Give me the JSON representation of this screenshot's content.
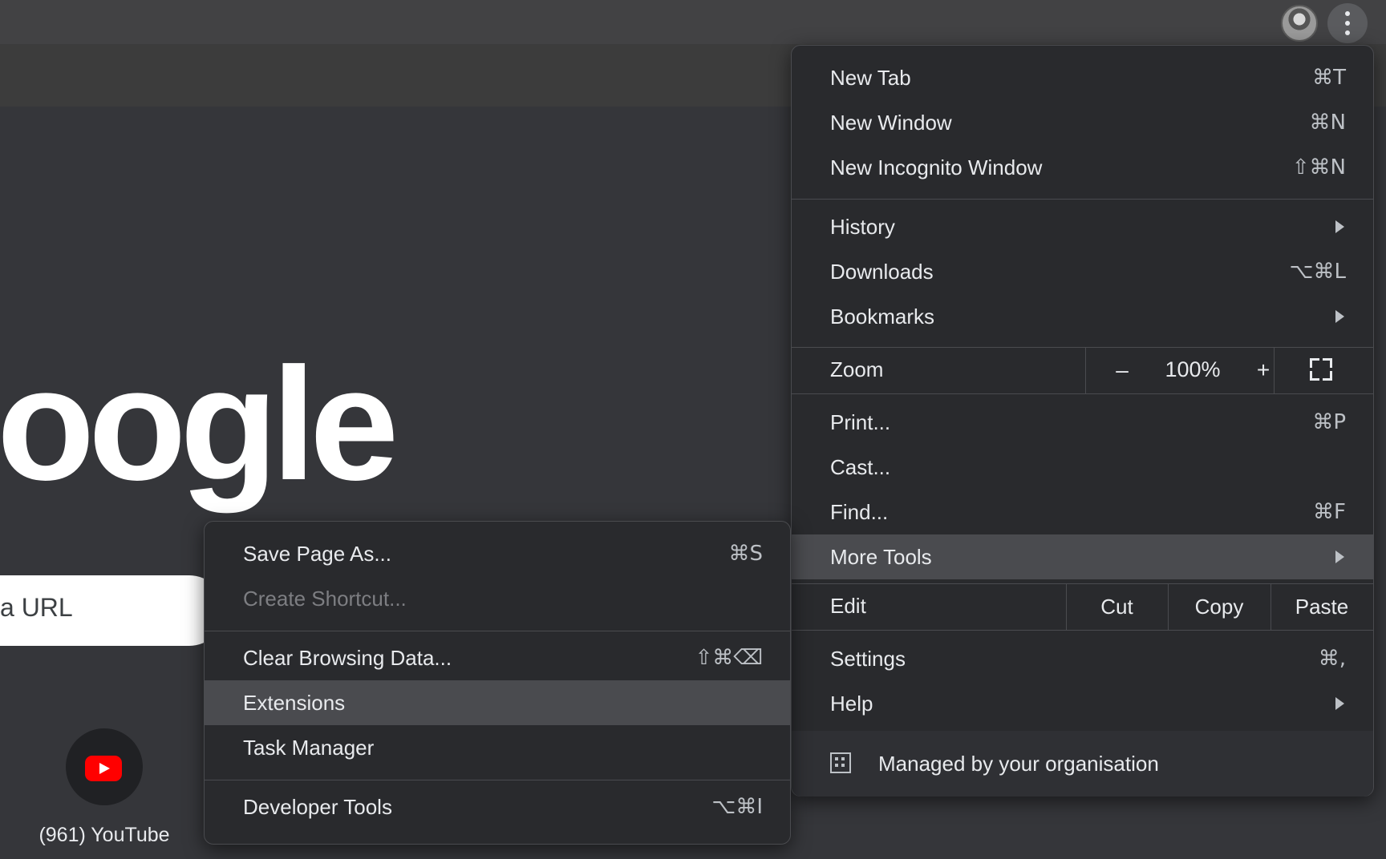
{
  "page": {
    "logo_text": "oogle",
    "omnibox_text": "a URL",
    "shortcut_label": "(961) YouTube"
  },
  "toolbar": {
    "avatar": "profile-avatar",
    "menu_icon": "three-dot-menu-icon"
  },
  "main_menu": {
    "new_tab": {
      "label": "New Tab",
      "shortcut": "⌘T"
    },
    "new_window": {
      "label": "New Window",
      "shortcut": "⌘N"
    },
    "new_incognito": {
      "label": "New Incognito Window",
      "shortcut": "⇧⌘N"
    },
    "history": {
      "label": "History"
    },
    "downloads": {
      "label": "Downloads",
      "shortcut": "⌥⌘L"
    },
    "bookmarks": {
      "label": "Bookmarks"
    },
    "zoom": {
      "label": "Zoom",
      "minus": "–",
      "value": "100%",
      "plus": "+"
    },
    "print": {
      "label": "Print...",
      "shortcut": "⌘P"
    },
    "cast": {
      "label": "Cast..."
    },
    "find": {
      "label": "Find...",
      "shortcut": "⌘F"
    },
    "more_tools": {
      "label": "More Tools"
    },
    "edit": {
      "label": "Edit",
      "cut": "Cut",
      "copy": "Copy",
      "paste": "Paste"
    },
    "settings": {
      "label": "Settings",
      "shortcut": "⌘,"
    },
    "help": {
      "label": "Help"
    },
    "managed": {
      "label": "Managed by your organisation"
    }
  },
  "sub_menu": {
    "save_page": {
      "label": "Save Page As...",
      "shortcut": "⌘S"
    },
    "create_shortcut": {
      "label": "Create Shortcut..."
    },
    "clear_data": {
      "label": "Clear Browsing Data...",
      "shortcut": "⇧⌘⌫"
    },
    "extensions": {
      "label": "Extensions"
    },
    "task_manager": {
      "label": "Task Manager"
    },
    "dev_tools": {
      "label": "Developer Tools",
      "shortcut": "⌥⌘I"
    }
  },
  "colors": {
    "background": "#35363a",
    "menu": "#292a2d",
    "highlight": "#4a4b4f",
    "youtube_red": "#ff0000"
  }
}
